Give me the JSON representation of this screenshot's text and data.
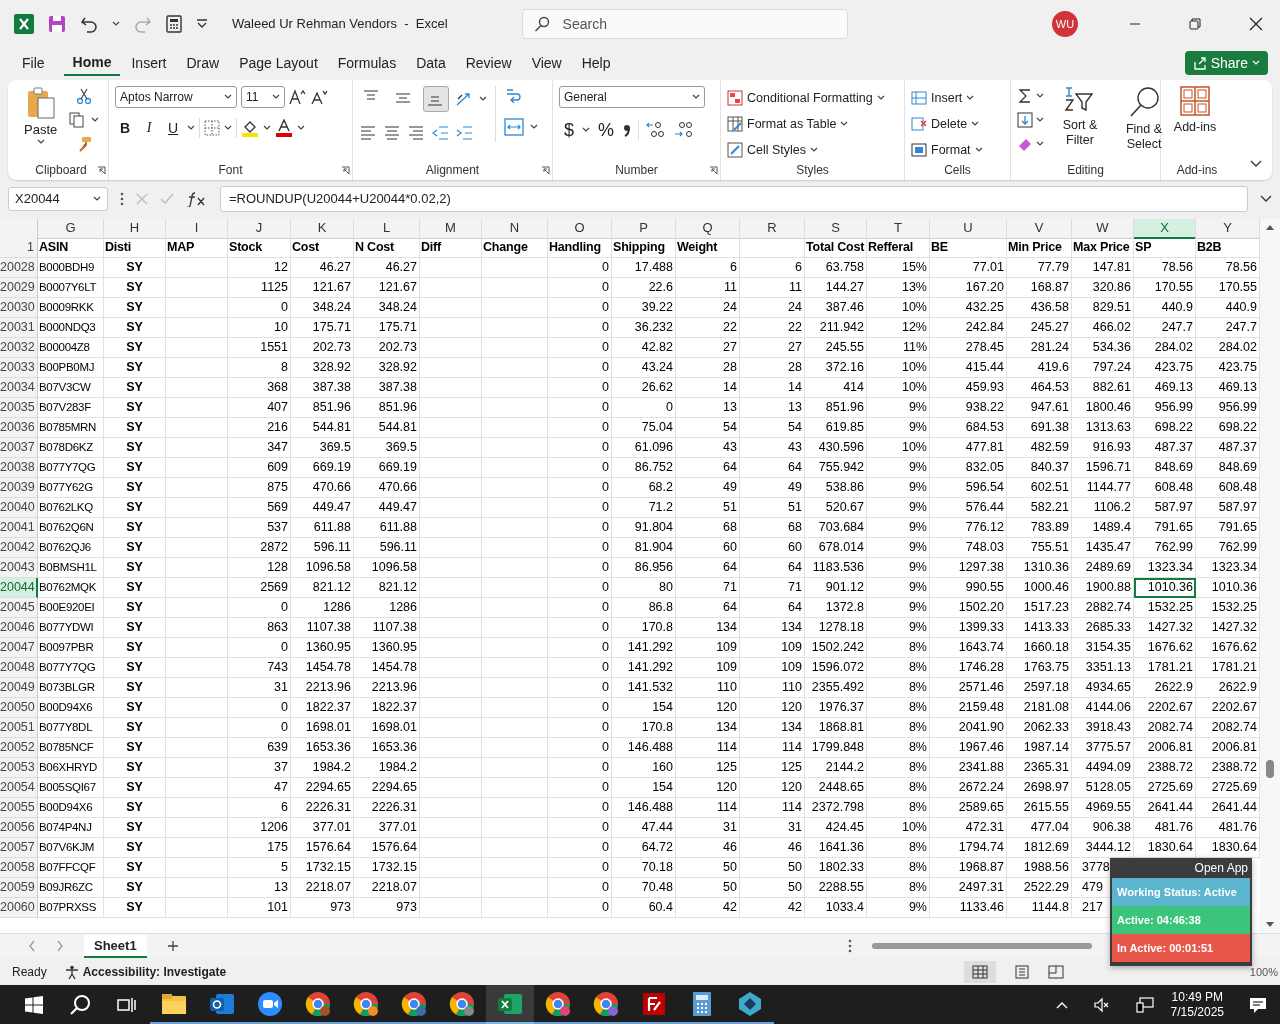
{
  "titlebar": {
    "title": "Waleed Ur Rehman Vendors  -  Excel",
    "search_placeholder": "Search",
    "avatar": "WU"
  },
  "menu_tabs": [
    {
      "label": "File",
      "selected": false
    },
    {
      "label": "Home",
      "selected": true
    },
    {
      "label": "Insert",
      "selected": false
    },
    {
      "label": "Draw",
      "selected": false
    },
    {
      "label": "Page Layout",
      "selected": false
    },
    {
      "label": "Formulas",
      "selected": false
    },
    {
      "label": "Data",
      "selected": false
    },
    {
      "label": "Review",
      "selected": false
    },
    {
      "label": "View",
      "selected": false
    },
    {
      "label": "Help",
      "selected": false
    }
  ],
  "share": "Share",
  "ribbon": {
    "clipboard": {
      "paste": "Paste",
      "label": "Clipboard"
    },
    "font": {
      "face": "Aptos Narrow",
      "size": "11",
      "bold": "B",
      "italic": "I",
      "underline": "U",
      "label": "Font"
    },
    "alignment": {
      "vertical": [
        {
          "selected": false
        },
        {
          "selected": false
        },
        {
          "selected": true
        }
      ],
      "label": "Alignment"
    },
    "number": {
      "format": "General",
      "currency": "$",
      "percent": "%",
      "label": "Number"
    },
    "styles": {
      "items": [
        "Conditional Formatting",
        "Format as Table",
        "Cell Styles"
      ],
      "label": "Styles"
    },
    "cells": {
      "items": [
        "Insert",
        "Delete",
        "Format"
      ],
      "label": "Cells"
    },
    "editing": {
      "items": [
        "Sort & Filter",
        "Find & Select"
      ],
      "label": "Editing"
    },
    "addins": {
      "button": "Add-ins",
      "label": "Add-ins"
    }
  },
  "formula_bar": {
    "name_box": "X20044",
    "formula": "=ROUNDUP(U20044+U20044*0.02,2)"
  },
  "columns": [
    {
      "letter": "G",
      "header": "ASIN",
      "selected": false
    },
    {
      "letter": "H",
      "header": "Disti",
      "selected": false
    },
    {
      "letter": "I",
      "header": "MAP",
      "selected": false
    },
    {
      "letter": "J",
      "header": "Stock",
      "selected": false
    },
    {
      "letter": "K",
      "header": "Cost",
      "selected": false
    },
    {
      "letter": "L",
      "header": "N Cost",
      "selected": false
    },
    {
      "letter": "M",
      "header": "Diff",
      "selected": false
    },
    {
      "letter": "N",
      "header": "Change",
      "selected": false
    },
    {
      "letter": "O",
      "header": "Handling",
      "selected": false
    },
    {
      "letter": "P",
      "header": "Shipping",
      "selected": false
    },
    {
      "letter": "Q",
      "header": "Weight",
      "selected": false
    },
    {
      "letter": "R",
      "selected": false
    },
    {
      "letter": "S",
      "header": "Total Cost",
      "selected": false
    },
    {
      "letter": "T",
      "header": "Refferal",
      "selected": false
    },
    {
      "letter": "U",
      "header": "BE",
      "selected": false
    },
    {
      "letter": "V",
      "header": "Min Price",
      "selected": false
    },
    {
      "letter": "W",
      "header": "Max Price",
      "selected": false
    },
    {
      "letter": "X",
      "header": "SP",
      "selected": true
    },
    {
      "letter": "Y",
      "header": "B2B",
      "selected": false
    }
  ],
  "header_row": "1",
  "rows": [
    {
      "n": "20028",
      "selected": false,
      "cells": [
        "B000BDH9",
        "SY",
        null,
        "12",
        "46.27",
        "46.27",
        null,
        null,
        "0",
        "17.488",
        "6",
        "6",
        "63.758",
        "15%",
        "77.01",
        "77.79",
        "147.81",
        "78.56",
        "78.56"
      ]
    },
    {
      "n": "20029",
      "selected": false,
      "cells": [
        "B0007Y6LT",
        "SY",
        null,
        "1125",
        "121.67",
        "121.67",
        null,
        null,
        "0",
        "22.6",
        "11",
        "11",
        "144.27",
        "13%",
        "167.20",
        "168.87",
        "320.86",
        "170.55",
        "170.55"
      ]
    },
    {
      "n": "20030",
      "selected": false,
      "cells": [
        "B0009RKK",
        "SY",
        null,
        "0",
        "348.24",
        "348.24",
        null,
        null,
        "0",
        "39.22",
        "24",
        "24",
        "387.46",
        "10%",
        "432.25",
        "436.58",
        "829.51",
        "440.9",
        "440.9"
      ]
    },
    {
      "n": "20031",
      "selected": false,
      "cells": [
        "B000NDQ3",
        "SY",
        null,
        "10",
        "175.71",
        "175.71",
        null,
        null,
        "0",
        "36.232",
        "22",
        "22",
        "211.942",
        "12%",
        "242.84",
        "245.27",
        "466.02",
        "247.7",
        "247.7"
      ]
    },
    {
      "n": "20032",
      "selected": false,
      "cells": [
        "B00004Z8",
        "SY",
        null,
        "1551",
        "202.73",
        "202.73",
        null,
        null,
        "0",
        "42.82",
        "27",
        "27",
        "245.55",
        "11%",
        "278.45",
        "281.24",
        "534.36",
        "284.02",
        "284.02"
      ]
    },
    {
      "n": "20033",
      "selected": false,
      "cells": [
        "B00PB0MJ",
        "SY",
        null,
        "8",
        "328.92",
        "328.92",
        null,
        null,
        "0",
        "43.24",
        "28",
        "28",
        "372.16",
        "10%",
        "415.44",
        "419.6",
        "797.24",
        "423.75",
        "423.75"
      ]
    },
    {
      "n": "20034",
      "selected": false,
      "cells": [
        "B07V3CW",
        "SY",
        null,
        "368",
        "387.38",
        "387.38",
        null,
        null,
        "0",
        "26.62",
        "14",
        "14",
        "414",
        "10%",
        "459.93",
        "464.53",
        "882.61",
        "469.13",
        "469.13"
      ]
    },
    {
      "n": "20035",
      "selected": false,
      "cells": [
        "B07V283F",
        "SY",
        null,
        "407",
        "851.96",
        "851.96",
        null,
        null,
        "0",
        "0",
        "13",
        "13",
        "851.96",
        "9%",
        "938.22",
        "947.61",
        "1800.46",
        "956.99",
        "956.99"
      ]
    },
    {
      "n": "20036",
      "selected": false,
      "cells": [
        "B0785MRN",
        "SY",
        null,
        "216",
        "544.81",
        "544.81",
        null,
        null,
        "0",
        "75.04",
        "54",
        "54",
        "619.85",
        "9%",
        "684.53",
        "691.38",
        "1313.63",
        "698.22",
        "698.22"
      ]
    },
    {
      "n": "20037",
      "selected": false,
      "cells": [
        "B078D6KZ",
        "SY",
        null,
        "347",
        "369.5",
        "369.5",
        null,
        null,
        "0",
        "61.096",
        "43",
        "43",
        "430.596",
        "10%",
        "477.81",
        "482.59",
        "916.93",
        "487.37",
        "487.37"
      ]
    },
    {
      "n": "20038",
      "selected": false,
      "cells": [
        "B077Y7QG",
        "SY",
        null,
        "609",
        "669.19",
        "669.19",
        null,
        null,
        "0",
        "86.752",
        "64",
        "64",
        "755.942",
        "9%",
        "832.05",
        "840.37",
        "1596.71",
        "848.69",
        "848.69"
      ]
    },
    {
      "n": "20039",
      "selected": false,
      "cells": [
        "B077Y62G",
        "SY",
        null,
        "875",
        "470.66",
        "470.66",
        null,
        null,
        "0",
        "68.2",
        "49",
        "49",
        "538.86",
        "9%",
        "596.54",
        "602.51",
        "1144.77",
        "608.48",
        "608.48"
      ]
    },
    {
      "n": "20040",
      "selected": false,
      "cells": [
        "B0762LKQ",
        "SY",
        null,
        "569",
        "449.47",
        "449.47",
        null,
        null,
        "0",
        "71.2",
        "51",
        "51",
        "520.67",
        "9%",
        "576.44",
        "582.21",
        "1106.2",
        "587.97",
        "587.97"
      ]
    },
    {
      "n": "20041",
      "selected": false,
      "cells": [
        "B0762Q6N",
        "SY",
        null,
        "537",
        "611.88",
        "611.88",
        null,
        null,
        "0",
        "91.804",
        "68",
        "68",
        "703.684",
        "9%",
        "776.12",
        "783.89",
        "1489.4",
        "791.65",
        "791.65"
      ]
    },
    {
      "n": "20042",
      "selected": false,
      "cells": [
        "B0762QJ6",
        "SY",
        null,
        "2872",
        "596.11",
        "596.11",
        null,
        null,
        "0",
        "81.904",
        "60",
        "60",
        "678.014",
        "9%",
        "748.03",
        "755.51",
        "1435.47",
        "762.99",
        "762.99"
      ]
    },
    {
      "n": "20043",
      "selected": false,
      "cells": [
        "B0BMSH1L",
        "SY",
        null,
        "128",
        "1096.58",
        "1096.58",
        null,
        null,
        "0",
        "86.956",
        "64",
        "64",
        "1183.536",
        "9%",
        "1297.38",
        "1310.36",
        "2489.69",
        "1323.34",
        "1323.34"
      ]
    },
    {
      "n": "20044",
      "selected": true,
      "cells": [
        "B0762MQK",
        "SY",
        null,
        "2569",
        "821.12",
        "821.12",
        null,
        null,
        "0",
        "80",
        "71",
        "71",
        "901.12",
        "9%",
        "990.55",
        "1000.46",
        "1900.88",
        "1010.36",
        "1010.36"
      ]
    },
    {
      "n": "20045",
      "selected": false,
      "cells": [
        "B00E920EI",
        "SY",
        null,
        "0",
        "1286",
        "1286",
        null,
        null,
        "0",
        "86.8",
        "64",
        "64",
        "1372.8",
        "9%",
        "1502.20",
        "1517.23",
        "2882.74",
        "1532.25",
        "1532.25"
      ]
    },
    {
      "n": "20046",
      "selected": false,
      "cells": [
        "B077YDWI",
        "SY",
        null,
        "863",
        "1107.38",
        "1107.38",
        null,
        null,
        "0",
        "170.8",
        "134",
        "134",
        "1278.18",
        "9%",
        "1399.33",
        "1413.33",
        "2685.33",
        "1427.32",
        "1427.32"
      ]
    },
    {
      "n": "20047",
      "selected": false,
      "cells": [
        "B0097PBR",
        "SY",
        null,
        "0",
        "1360.95",
        "1360.95",
        null,
        null,
        "0",
        "141.292",
        "109",
        "109",
        "1502.242",
        "8%",
        "1643.74",
        "1660.18",
        "3154.35",
        "1676.62",
        "1676.62"
      ]
    },
    {
      "n": "20048",
      "selected": false,
      "cells": [
        "B077Y7QG",
        "SY",
        null,
        "743",
        "1454.78",
        "1454.78",
        null,
        null,
        "0",
        "141.292",
        "109",
        "109",
        "1596.072",
        "8%",
        "1746.28",
        "1763.75",
        "3351.13",
        "1781.21",
        "1781.21"
      ]
    },
    {
      "n": "20049",
      "selected": false,
      "cells": [
        "B073BLGR",
        "SY",
        null,
        "31",
        "2213.96",
        "2213.96",
        null,
        null,
        "0",
        "141.532",
        "110",
        "110",
        "2355.492",
        "8%",
        "2571.46",
        "2597.18",
        "4934.65",
        "2622.9",
        "2622.9"
      ]
    },
    {
      "n": "20050",
      "selected": false,
      "cells": [
        "B00D94X6",
        "SY",
        null,
        "0",
        "1822.37",
        "1822.37",
        null,
        null,
        "0",
        "154",
        "120",
        "120",
        "1976.37",
        "8%",
        "2159.48",
        "2181.08",
        "4144.06",
        "2202.67",
        "2202.67"
      ]
    },
    {
      "n": "20051",
      "selected": false,
      "cells": [
        "B077Y8DL",
        "SY",
        null,
        "0",
        "1698.01",
        "1698.01",
        null,
        null,
        "0",
        "170.8",
        "134",
        "134",
        "1868.81",
        "8%",
        "2041.90",
        "2062.33",
        "3918.43",
        "2082.74",
        "2082.74"
      ]
    },
    {
      "n": "20052",
      "selected": false,
      "cells": [
        "B0785NCF",
        "SY",
        null,
        "639",
        "1653.36",
        "1653.36",
        null,
        null,
        "0",
        "146.488",
        "114",
        "114",
        "1799.848",
        "8%",
        "1967.46",
        "1987.14",
        "3775.57",
        "2006.81",
        "2006.81"
      ]
    },
    {
      "n": "20053",
      "selected": false,
      "cells": [
        "B06XHRYD",
        "SY",
        null,
        "37",
        "1984.2",
        "1984.2",
        null,
        null,
        "0",
        "160",
        "125",
        "125",
        "2144.2",
        "8%",
        "2341.88",
        "2365.31",
        "4494.09",
        "2388.72",
        "2388.72"
      ]
    },
    {
      "n": "20054",
      "selected": false,
      "cells": [
        "B005SQI67",
        "SY",
        null,
        "47",
        "2294.65",
        "2294.65",
        null,
        null,
        "0",
        "154",
        "120",
        "120",
        "2448.65",
        "8%",
        "2672.24",
        "2698.97",
        "5128.05",
        "2725.69",
        "2725.69"
      ]
    },
    {
      "n": "20055",
      "selected": false,
      "cells": [
        "B00D94X6",
        "SY",
        null,
        "6",
        "2226.31",
        "2226.31",
        null,
        null,
        "0",
        "146.488",
        "114",
        "114",
        "2372.798",
        "8%",
        "2589.65",
        "2615.55",
        "4969.55",
        "2641.44",
        "2641.44"
      ]
    },
    {
      "n": "20056",
      "selected": false,
      "cells": [
        "B074P4NJ",
        "SY",
        null,
        "1206",
        "377.01",
        "377.01",
        null,
        null,
        "0",
        "47.44",
        "31",
        "31",
        "424.45",
        "10%",
        "472.31",
        "477.04",
        "906.38",
        "481.76",
        "481.76"
      ]
    },
    {
      "n": "20057",
      "selected": false,
      "cells": [
        "B07V6KJM",
        "SY",
        null,
        "175",
        "1576.64",
        "1576.64",
        null,
        null,
        "0",
        "64.72",
        "46",
        "46",
        "1641.36",
        "8%",
        "1794.74",
        "1812.69",
        "3444.12",
        "1830.64",
        "1830.64"
      ]
    },
    {
      "n": "20058",
      "selected": false,
      "cells": [
        "B07FFCQF",
        "SY",
        null,
        "5",
        "1732.15",
        "1732.15",
        null,
        null,
        "0",
        "70.18",
        "50",
        "50",
        "1802.33",
        "8%",
        "1968.87",
        "1988.56",
        "3778"
      ]
    },
    {
      "n": "20059",
      "selected": false,
      "cells": [
        "B09JR6ZC",
        "SY",
        null,
        "13",
        "2218.07",
        "2218.07",
        null,
        null,
        "0",
        "70.48",
        "50",
        "50",
        "2288.55",
        "8%",
        "2497.31",
        "2522.29",
        "479"
      ]
    },
    {
      "n": "20060",
      "selected": false,
      "cells": [
        "B07PRXSS",
        "SY",
        null,
        "101",
        "973",
        "973",
        null,
        null,
        "0",
        "60.4",
        "42",
        "42",
        "1033.4",
        "9%",
        "1133.46",
        "1144.8",
        "217"
      ]
    }
  ],
  "sheet_tabs": [
    {
      "label": "Sheet1",
      "selected": true
    }
  ],
  "status_bar": {
    "status": "Ready",
    "accessibility": "Accessibility: Investigate",
    "zoom": "100%"
  },
  "tracker": {
    "open_app": "Open App",
    "working_status": "Working Status: Active",
    "active": "Active: 04:46:38",
    "inactive": "In Active: 00:01:51"
  },
  "taskbar": {
    "time": "10:49 PM",
    "date": "7/15/2025"
  }
}
